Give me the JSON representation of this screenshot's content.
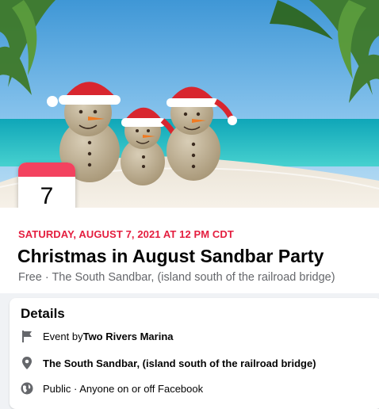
{
  "cover": {
    "image_name": "sand-snowmen-santa-hats-beach"
  },
  "date_badge": {
    "day": "7",
    "accent_color": "#f3425f"
  },
  "event": {
    "datetime": "SATURDAY, AUGUST 7, 2021 AT 12 PM CDT",
    "title": "Christmas in August Sandbar Party",
    "subtitle": "Free · The South Sandbar, (island south of the railroad bridge)"
  },
  "details": {
    "heading": "Details",
    "host_prefix": "Event by ",
    "host_name": "Two Rivers Marina",
    "location": "The South Sandbar, (island south of the railroad bridge)",
    "privacy": "Public · Anyone on or off Facebook",
    "icons": [
      "flag-icon",
      "location-pin-icon",
      "globe-icon"
    ]
  },
  "colors": {
    "date_text": "#e41e3f",
    "page_bg": "#f0f2f5"
  }
}
